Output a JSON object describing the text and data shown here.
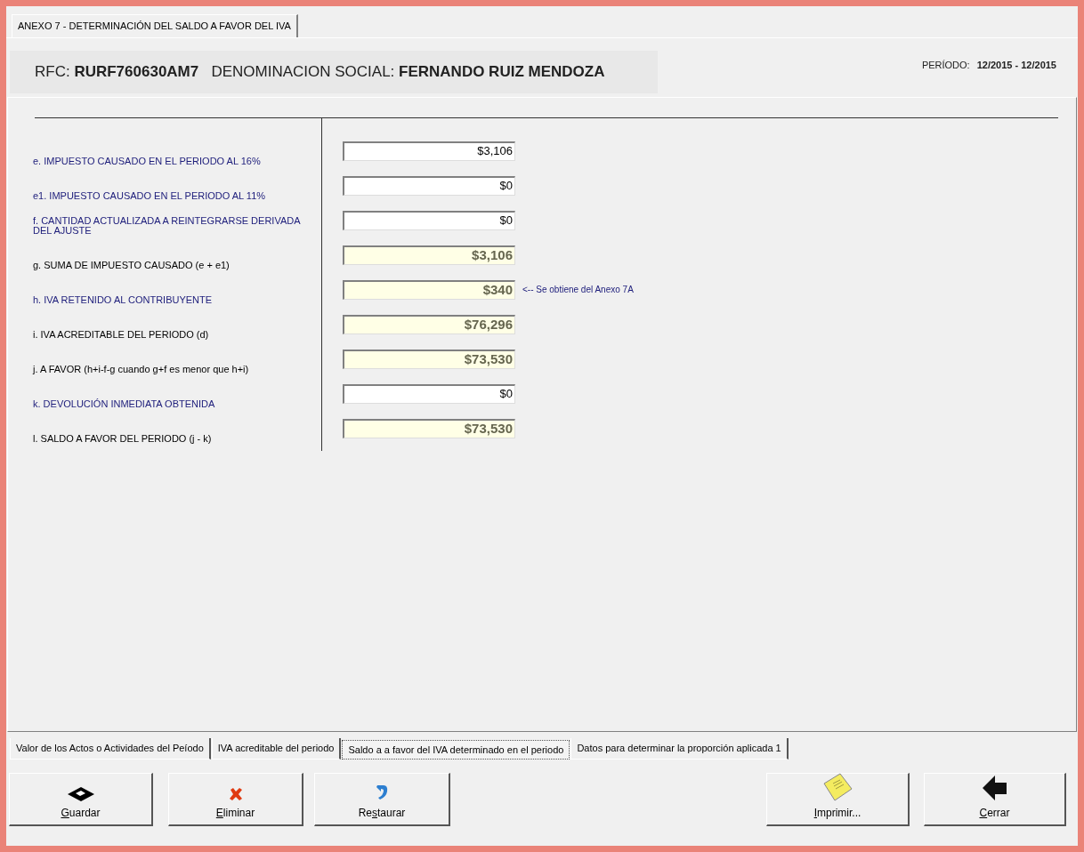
{
  "window": {
    "title": "ANEXO 7  -  DETERMINACIÓN DEL SALDO A FAVOR DEL IVA"
  },
  "header": {
    "rfc_label": "RFC:",
    "rfc": "RURF760630AM7",
    "name_label": "DENOMINACION SOCIAL:",
    "name": "FERNANDO RUIZ MENDOZA",
    "period_label": "PERÍODO:",
    "period": "12/2015 - 12/2015"
  },
  "rows": [
    {
      "label": "e. IMPUESTO CAUSADO EN EL PERIODO AL 16%",
      "color": "#1c1c7a",
      "kind": "input",
      "value": "$3,106"
    },
    {
      "label": "e1. IMPUESTO CAUSADO EN EL PERIODO AL 11%",
      "color": "#1c1c7a",
      "kind": "input",
      "value": "$0"
    },
    {
      "label": "f. CANTIDAD ACTUALIZADA A REINTEGRARSE DERIVADA DEL AJUSTE",
      "color": "#1c1c7a",
      "kind": "input",
      "value": "$0"
    },
    {
      "label": "g. SUMA DE IMPUESTO CAUSADO (e + e1)",
      "color": "#000000",
      "kind": "computed",
      "value": "$3,106"
    },
    {
      "label": "h.  IVA RETENIDO AL CONTRIBUYENTE",
      "color": "#1c1c7a",
      "kind": "computed",
      "value": "$340",
      "note": "<-- Se obtiene del Anexo 7A"
    },
    {
      "label": "i. IVA ACREDITABLE DEL PERIODO (d)",
      "color": "#000000",
      "kind": "computed",
      "value": "$76,296"
    },
    {
      "label": "j. A FAVOR (h+i-f-g cuando g+f es menor que h+i)",
      "color": "#000000",
      "kind": "computed",
      "value": "$73,530"
    },
    {
      "label": "k. DEVOLUCIÓN INMEDIATA OBTENIDA",
      "color": "#1c1c7a",
      "kind": "input",
      "value": "$0"
    },
    {
      "label": "l. SALDO A FAVOR DEL PERIODO (j - k)",
      "color": "#000000",
      "kind": "computed",
      "value": "$73,530"
    }
  ],
  "tabs": [
    {
      "label": "Valor de los Actos o Actividades del Peíodo",
      "selected": false
    },
    {
      "label": "IVA acreditable del periodo",
      "selected": false
    },
    {
      "label": "Saldo a a favor del IVA determinado en el periodo",
      "selected": true
    },
    {
      "label": "Datos para determinar la proporción aplicada 1",
      "selected": false
    }
  ],
  "buttons": [
    {
      "kind": "save",
      "access_key": "G",
      "label_rest": "uardar"
    },
    {
      "kind": "delete",
      "access_key": "E",
      "label_rest": "liminar"
    },
    {
      "kind": "restore",
      "label_start": "Re",
      "access_key": "s",
      "label_rest": "taurar"
    },
    {
      "kind": "print",
      "access_key": "I",
      "label_rest": "mprimir..."
    },
    {
      "kind": "close",
      "access_key": "C",
      "label_rest": "errar"
    }
  ]
}
